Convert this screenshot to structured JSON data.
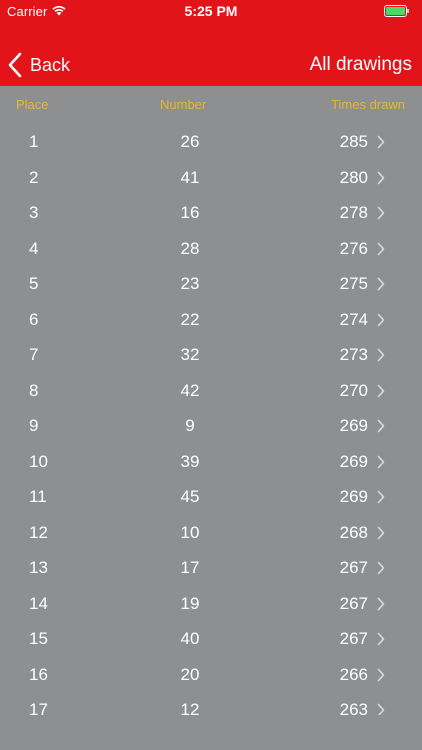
{
  "status_bar": {
    "carrier": "Carrier",
    "time": "5:25 PM"
  },
  "nav": {
    "back_label": "Back",
    "title": "All drawings"
  },
  "columns": {
    "place": "Place",
    "number": "Number",
    "times_drawn": "Times drawn"
  },
  "rows": [
    {
      "place": "1",
      "number": "26",
      "times": "285"
    },
    {
      "place": "2",
      "number": "41",
      "times": "280"
    },
    {
      "place": "3",
      "number": "16",
      "times": "278"
    },
    {
      "place": "4",
      "number": "28",
      "times": "276"
    },
    {
      "place": "5",
      "number": "23",
      "times": "275"
    },
    {
      "place": "6",
      "number": "22",
      "times": "274"
    },
    {
      "place": "7",
      "number": "32",
      "times": "273"
    },
    {
      "place": "8",
      "number": "42",
      "times": "270"
    },
    {
      "place": "9",
      "number": "9",
      "times": "269"
    },
    {
      "place": "10",
      "number": "39",
      "times": "269"
    },
    {
      "place": "11",
      "number": "45",
      "times": "269"
    },
    {
      "place": "12",
      "number": "10",
      "times": "268"
    },
    {
      "place": "13",
      "number": "17",
      "times": "267"
    },
    {
      "place": "14",
      "number": "19",
      "times": "267"
    },
    {
      "place": "15",
      "number": "40",
      "times": "267"
    },
    {
      "place": "16",
      "number": "20",
      "times": "266"
    },
    {
      "place": "17",
      "number": "12",
      "times": "263"
    }
  ],
  "colors": {
    "nav_background": "#e3131a",
    "list_background": "#8e8f91",
    "header_text": "#e6b72f",
    "row_text": "#ffffff",
    "battery_fill": "#4cd964"
  },
  "icons": {
    "wifi": "wifi-icon",
    "battery": "battery-icon",
    "back": "chevron-left-icon",
    "row_disclosure": "chevron-right-icon"
  }
}
